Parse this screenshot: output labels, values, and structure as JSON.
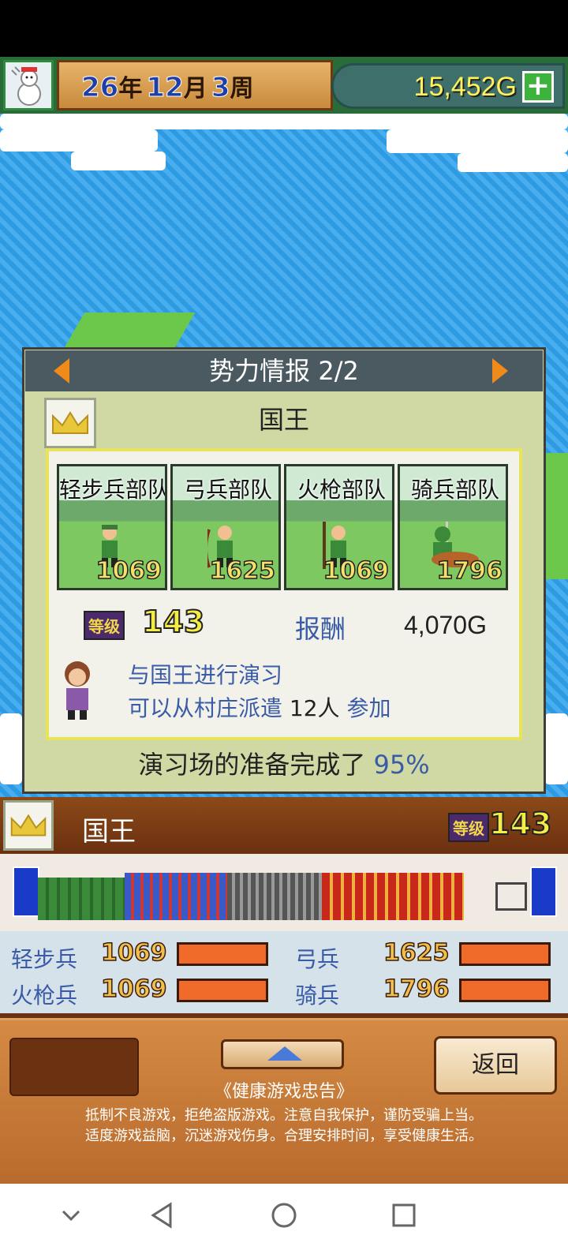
{
  "topbar": {
    "year": "26",
    "year_unit": "年",
    "month": "12",
    "month_unit": "月",
    "week": "3",
    "week_unit": "周",
    "gold": "15,452G",
    "plus_label": "+"
  },
  "dialog": {
    "title": "势力情报 2/2",
    "faction_name": "国王",
    "units": [
      {
        "name": "轻步兵部队",
        "count": "1069"
      },
      {
        "name": "弓兵部队",
        "count": "1625"
      },
      {
        "name": "火枪部队",
        "count": "1069"
      },
      {
        "name": "骑兵部队",
        "count": "1796"
      }
    ],
    "level_badge": "等级",
    "level": "143",
    "reward_label": "报酬",
    "reward_value": "4,070G",
    "drill_line1": "与国王进行演习",
    "drill_line2_prefix": "可以从村庄派遣",
    "drill_count": "12人",
    "drill_join": "参加",
    "prep_text": "演习场的准备完成了",
    "prep_percent": "95%"
  },
  "lord_bar": {
    "name": "国王",
    "level_badge": "等级",
    "level": "143"
  },
  "stats": [
    {
      "label": "轻步兵",
      "value": "1069",
      "fill": 1.0
    },
    {
      "label": "弓兵",
      "value": "1625",
      "fill": 1.0
    },
    {
      "label": "火枪兵",
      "value": "1069",
      "fill": 1.0
    },
    {
      "label": "骑兵",
      "value": "1796",
      "fill": 1.0
    }
  ],
  "controls": {
    "back_label": "返回",
    "advice_title": "《健康游戏忠告》",
    "advice_line1": "抵制不良游戏，拒绝盗版游戏。注意自我保护，谨防受骗上当。",
    "advice_line2": "适度游戏益脑，沉迷游戏伤身。合理安排时间，享受健康生活。"
  },
  "icons": {
    "avatar": "snowman-icon",
    "crown": "crown-icon",
    "prev": "arrow-left-icon",
    "next": "arrow-right-icon",
    "scroll_up": "triangle-up-icon",
    "nav_back": "nav-back-icon",
    "nav_home": "nav-home-icon",
    "nav_recents": "nav-recents-icon",
    "nav_down": "nav-chevron-down-icon"
  },
  "colors": {
    "accent_blue": "#3a5ca8",
    "gold_text": "#fff25a",
    "dialog_bg": "#d0d9a4"
  }
}
